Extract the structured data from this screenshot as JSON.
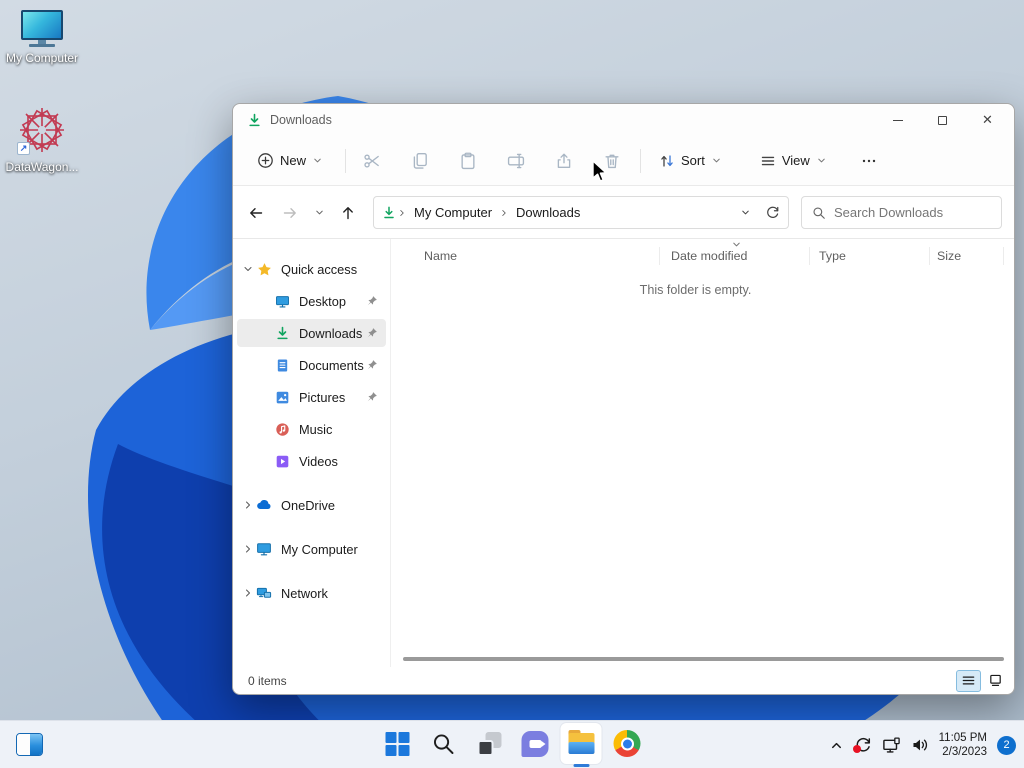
{
  "desktop": {
    "icons": [
      {
        "label": "My Computer"
      },
      {
        "label": "DataWagon..."
      }
    ]
  },
  "window": {
    "title": "Downloads",
    "toolbar": {
      "new": "New",
      "sort": "Sort",
      "view": "View"
    },
    "address": {
      "crumbs": [
        "My Computer",
        "Downloads"
      ],
      "search_placeholder": "Search Downloads"
    },
    "sidebar": {
      "items": [
        {
          "label": "Quick access"
        },
        {
          "label": "Desktop"
        },
        {
          "label": "Downloads"
        },
        {
          "label": "Documents"
        },
        {
          "label": "Pictures"
        },
        {
          "label": "Music"
        },
        {
          "label": "Videos"
        },
        {
          "label": "OneDrive"
        },
        {
          "label": "My Computer"
        },
        {
          "label": "Network"
        }
      ]
    },
    "columns": {
      "name": "Name",
      "date": "Date modified",
      "type": "Type",
      "size": "Size"
    },
    "empty_message": "This folder is empty.",
    "status": {
      "count": "0 items"
    }
  },
  "taskbar": {
    "clock_time": "11:05 PM",
    "clock_date": "2/3/2023",
    "badge": "2"
  },
  "colors": {
    "accent_blue": "#0e6fce",
    "download_green": "#10a45f",
    "selection_gray": "#ececec",
    "taskbar_bg": "#eef2f8"
  }
}
